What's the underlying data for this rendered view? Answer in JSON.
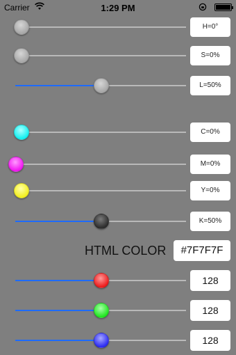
{
  "status": {
    "carrier": "Carrier",
    "time": "1:29 PM"
  },
  "hsl": [
    {
      "label": "H=0°",
      "value_fraction": 0.0,
      "thumb": "gray"
    },
    {
      "label": "S=0%",
      "value_fraction": 0.0,
      "thumb": "gray"
    },
    {
      "label": "L=50%",
      "value_fraction": 0.5,
      "thumb": "gray"
    }
  ],
  "cmyk": [
    {
      "label": "C=0%",
      "value_fraction": 0.0,
      "thumb": "cyan"
    },
    {
      "label": "M=0%",
      "value_fraction": 0.0,
      "thumb": "magenta"
    },
    {
      "label": "Y=0%",
      "value_fraction": 0.0,
      "thumb": "yellow"
    },
    {
      "label": "K=50%",
      "value_fraction": 0.5,
      "thumb": "dark"
    }
  ],
  "html_color": {
    "label": "HTML COLOR",
    "value": "#7F7F7F"
  },
  "rgb": [
    {
      "label": "128",
      "value_fraction": 0.502,
      "thumb": "red"
    },
    {
      "label": "128",
      "value_fraction": 0.502,
      "thumb": "green"
    },
    {
      "label": "128",
      "value_fraction": 0.502,
      "thumb": "blue"
    }
  ],
  "colors": {
    "background": "#7F7F7F",
    "track_fill": "#1E6BFF",
    "track": "#B9B9B9"
  }
}
